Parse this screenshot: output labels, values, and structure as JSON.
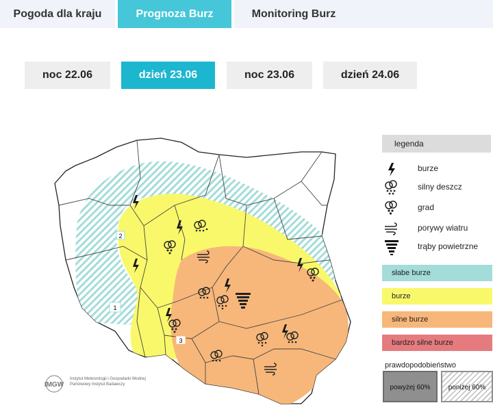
{
  "tabs": [
    {
      "label": "Pogoda dla kraju",
      "active": false
    },
    {
      "label": "Prognoza Burz",
      "active": true
    },
    {
      "label": "Monitoring Burz",
      "active": false
    }
  ],
  "days": [
    {
      "label": "noc 22.06",
      "active": false
    },
    {
      "label": "dzień 23.06",
      "active": true
    },
    {
      "label": "noc 23.06",
      "active": false
    },
    {
      "label": "dzień 24.06",
      "active": false
    }
  ],
  "legend": {
    "title": "legenda",
    "icons": [
      {
        "icon": "lightning-icon",
        "label": "burze"
      },
      {
        "icon": "heavy-rain-icon",
        "label": "silny deszcz"
      },
      {
        "icon": "hail-icon",
        "label": "grad"
      },
      {
        "icon": "wind-gust-icon",
        "label": "porywy wiatru"
      },
      {
        "icon": "tornado-icon",
        "label": "trąby powietrzne"
      }
    ],
    "levels": [
      {
        "label": "słabe burze",
        "color": "#a3dcd9"
      },
      {
        "label": "burze",
        "color": "#f9f86b"
      },
      {
        "label": "silne burze",
        "color": "#f7b77a"
      },
      {
        "label": "bardzo silne burze",
        "color": "#e57b7f"
      }
    ],
    "probability_title": "prawdopodobieństwo",
    "probability": [
      {
        "label": "powyżej 60%"
      },
      {
        "label": "poniżej 60%"
      }
    ]
  },
  "map": {
    "zone_markers": [
      "2",
      "1",
      "3"
    ],
    "colors": {
      "weak": "#a3dcd9",
      "storm": "#f9f86b",
      "strong": "#f7b77a"
    }
  },
  "logo": {
    "mark": "IMGW",
    "line1": "Instytut Meteorologii i Gospodarki Wodnej",
    "line2": "Państwowy Instytut Badawczy"
  }
}
